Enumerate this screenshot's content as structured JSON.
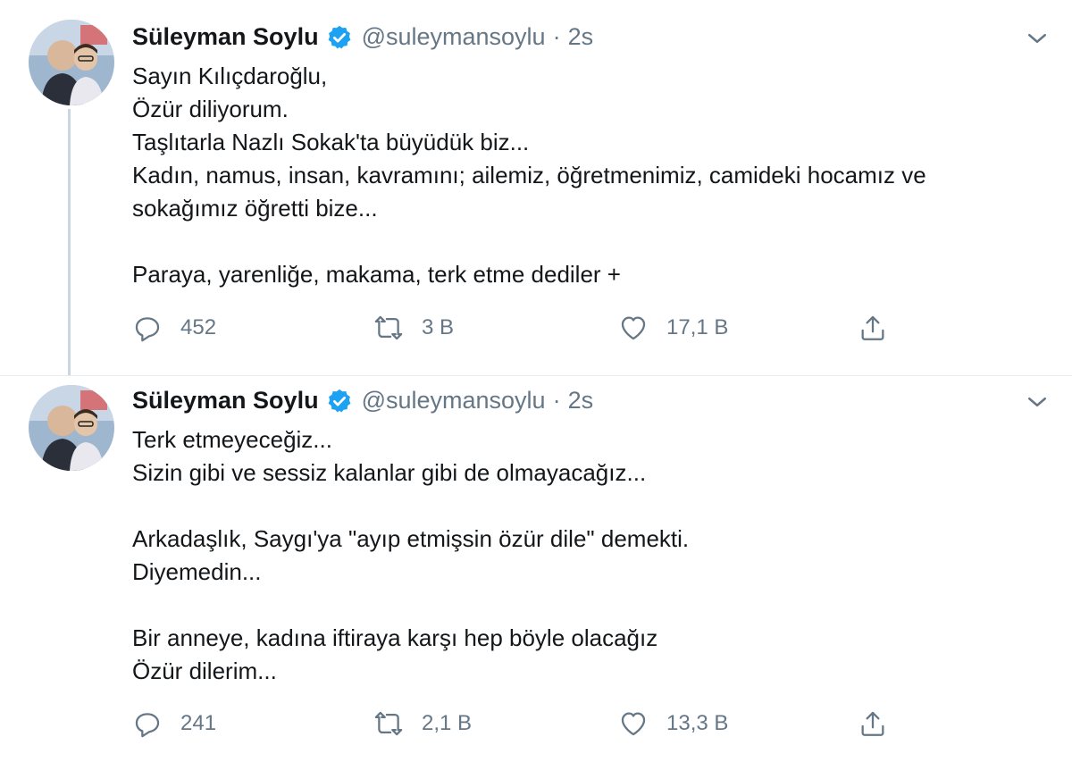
{
  "tweets": [
    {
      "author": {
        "name": "Süleyman Soylu",
        "handle": "@suleymansoylu",
        "verified": true
      },
      "separator": "·",
      "time": "2s",
      "lines": [
        "Sayın Kılıçdaroğlu,",
        "Özür diliyorum.",
        "Taşlıtarla Nazlı Sokak'ta büyüdük biz...",
        "Kadın, namus, insan, kavramını; ailemiz, öğretmenimiz, camideki hocamız ve",
        "sokağımız öğretti bize...",
        "",
        "Paraya, yarenliğe, makama, terk etme dediler +"
      ],
      "actions": {
        "replies": "452",
        "retweets": "3 B",
        "likes": "17,1 B"
      }
    },
    {
      "author": {
        "name": "Süleyman Soylu",
        "handle": "@suleymansoylu",
        "verified": true
      },
      "separator": "·",
      "time": "2s",
      "lines": [
        "Terk etmeyeceğiz...",
        "Sizin gibi ve sessiz kalanlar gibi de olmayacağız...",
        "",
        "Arkadaşlık, Saygı'ya \"ayıp etmişsin özür dile\" demekti.",
        "Diyemedin...",
        "",
        "Bir anneye, kadına iftiraya karşı hep böyle olacağız",
        "Özür dilerim..."
      ],
      "actions": {
        "replies": "241",
        "retweets": "2,1 B",
        "likes": "13,3 B"
      }
    }
  ],
  "icons": {
    "verified": "verified-badge-icon",
    "caret": "chevron-down-icon",
    "reply": "reply-icon",
    "retweet": "retweet-icon",
    "like": "heart-icon",
    "share": "share-icon"
  },
  "colors": {
    "verified": "#1da1f2",
    "muted": "#657786",
    "text": "#14171a",
    "thread": "#ccd6dd"
  }
}
